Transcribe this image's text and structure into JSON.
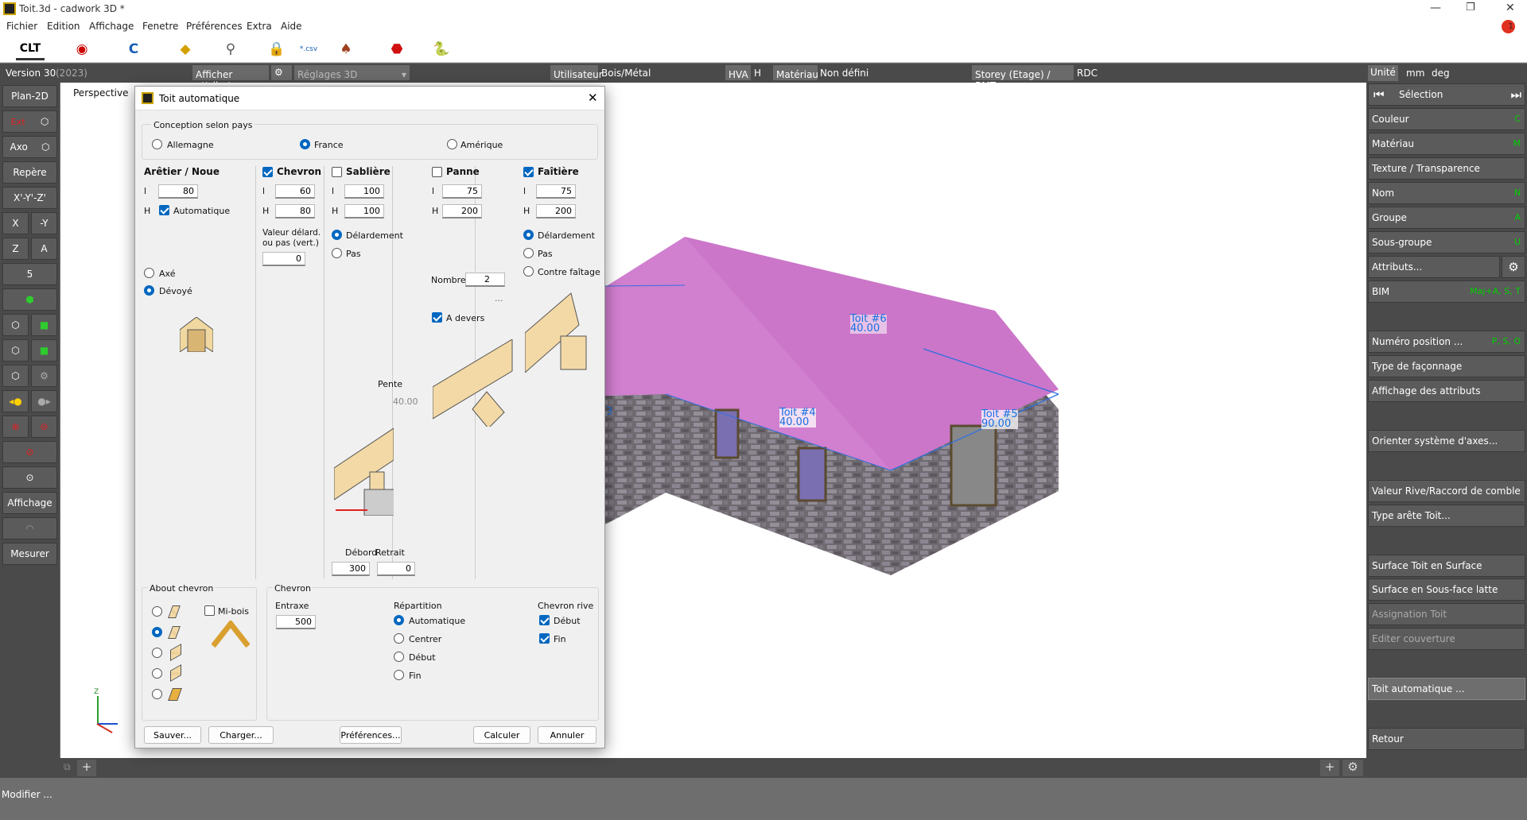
{
  "window": {
    "title": "Toit.3d - cadwork 3D *",
    "app_icon": "cadwork-logo",
    "controls": [
      "minimize-icon",
      "maximize-icon",
      "close-icon"
    ],
    "notification_count": "1"
  },
  "menu": [
    "Fichier",
    "Edition",
    "Affichage",
    "Fenetre",
    "Préférences",
    "Extra",
    "Aide"
  ],
  "toolbar": {
    "clt": "CLT",
    "icons": [
      "target-icon",
      "c-gear-icon",
      "beam-new-icon",
      "search-icon",
      "lock-icon",
      "csv-export-icon",
      "roof-tool-icon",
      "pdf-icon",
      "python-icon"
    ],
    "csv_label": "*.csv"
  },
  "infobar": {
    "version": "Version 30",
    "version_year": "(2023)",
    "afficher": "Afficher attribut",
    "reglages": "Réglages 3D",
    "utilisateur": "Utilisateur",
    "bois": "Bois/Métal",
    "hva": "HVA",
    "h": "H",
    "materiau": "Matériau",
    "non_defini": "Non défini",
    "storey": "Storey (Etage) / BMT",
    "rdc": "RDC",
    "unite": "Unité",
    "mm": "mm",
    "deg": "deg"
  },
  "left": {
    "plan2d": "Plan-2D",
    "ext": "Ext",
    "axo": "Axo",
    "repere": "Repère",
    "xyz": "X'-Y'-Z'",
    "x": "X",
    "my": "-Y",
    "z": "Z",
    "a": "A",
    "five": "5",
    "affichage": "Affichage",
    "mesurer": "Mesurer"
  },
  "viewport": {
    "label": "Perspective",
    "axis_z": "Z",
    "labels": [
      {
        "name": "Toit #6",
        "value": "40.00"
      },
      {
        "name": "Toit #4",
        "value": "40.00"
      },
      {
        "name": "Toit #5",
        "value": "90.00"
      }
    ],
    "partial": "3"
  },
  "right": {
    "selection": "Sélection",
    "items": [
      {
        "label": "Couleur",
        "key": "C"
      },
      {
        "label": "Matériau",
        "key": "M"
      },
      {
        "label": "Texture / Transparence",
        "key": ""
      },
      {
        "label": "Nom",
        "key": "N"
      },
      {
        "label": "Groupe",
        "key": "A"
      },
      {
        "label": "Sous-groupe",
        "key": "U"
      },
      {
        "label": "Attributs...",
        "key": ""
      },
      {
        "label": "BIM",
        "key": "Maj+A, S, T"
      },
      {
        "label": "Numéro position ...",
        "key": "P, S, O"
      },
      {
        "label": "Type de façonnage",
        "key": ""
      },
      {
        "label": "Affichage des attributs",
        "key": ""
      },
      {
        "label": "Orienter système d'axes...",
        "key": ""
      },
      {
        "label": "Valeur Rive/Raccord de comble",
        "key": ""
      },
      {
        "label": "Type arête Toit...",
        "key": ""
      },
      {
        "label": "Surface Toit en Surface",
        "key": ""
      },
      {
        "label": "Surface en Sous-face latte",
        "key": ""
      },
      {
        "label": "Assignation Toit",
        "key": ""
      },
      {
        "label": "Editer couverture",
        "key": ""
      },
      {
        "label": "Toit automatique ...",
        "key": ""
      },
      {
        "label": "Retour",
        "key": ""
      }
    ]
  },
  "status": "Modifier ...",
  "dialog": {
    "title": "Toit automatique",
    "conception": "Conception selon pays",
    "countries": [
      "Allemagne",
      "France",
      "Amérique"
    ],
    "aretier": {
      "title": "Arêtier / Noue",
      "l": "80",
      "h_label": "Automatique",
      "axe": "Axé",
      "devoye": "Dévoyé"
    },
    "chevron": {
      "title": "Chevron",
      "l": "60",
      "h": "80",
      "valeur": "Valeur délard.",
      "valeur2": "ou pas (vert.)",
      "valeur_val": "0"
    },
    "sabliere": {
      "title": "Sablière",
      "l": "100",
      "h": "100",
      "delard": "Délardement",
      "pas": "Pas",
      "pente": "Pente",
      "pente_val": "40.00",
      "debord": "Débord",
      "retrait": "Retrait",
      "debord_val": "300",
      "retrait_val": "0"
    },
    "panne": {
      "title": "Panne",
      "l": "75",
      "h": "200",
      "nombre": "Nombre",
      "nombre_val": "2",
      "dots": "...",
      "adevers": "A devers"
    },
    "faitiere": {
      "title": "Faîtière",
      "l": "75",
      "h": "200",
      "delard": "Délardement",
      "pas": "Pas",
      "contre": "Contre faîtage"
    },
    "l": "l",
    "H": "H",
    "about": {
      "title": "About chevron",
      "mibois": "Mi-bois"
    },
    "chevron2": {
      "title": "Chevron",
      "entraxe": "Entraxe",
      "entraxe_val": "500",
      "repartition": "Répartition",
      "rep": [
        "Automatique",
        "Centrer",
        "Début",
        "Fin"
      ],
      "rive": "Chevron rive",
      "rive_items": [
        "Début",
        "Fin"
      ]
    },
    "buttons": {
      "sauver": "Sauver...",
      "charger": "Charger...",
      "preferences": "Préférences...",
      "calculer": "Calculer",
      "annuler": "Annuler"
    }
  }
}
